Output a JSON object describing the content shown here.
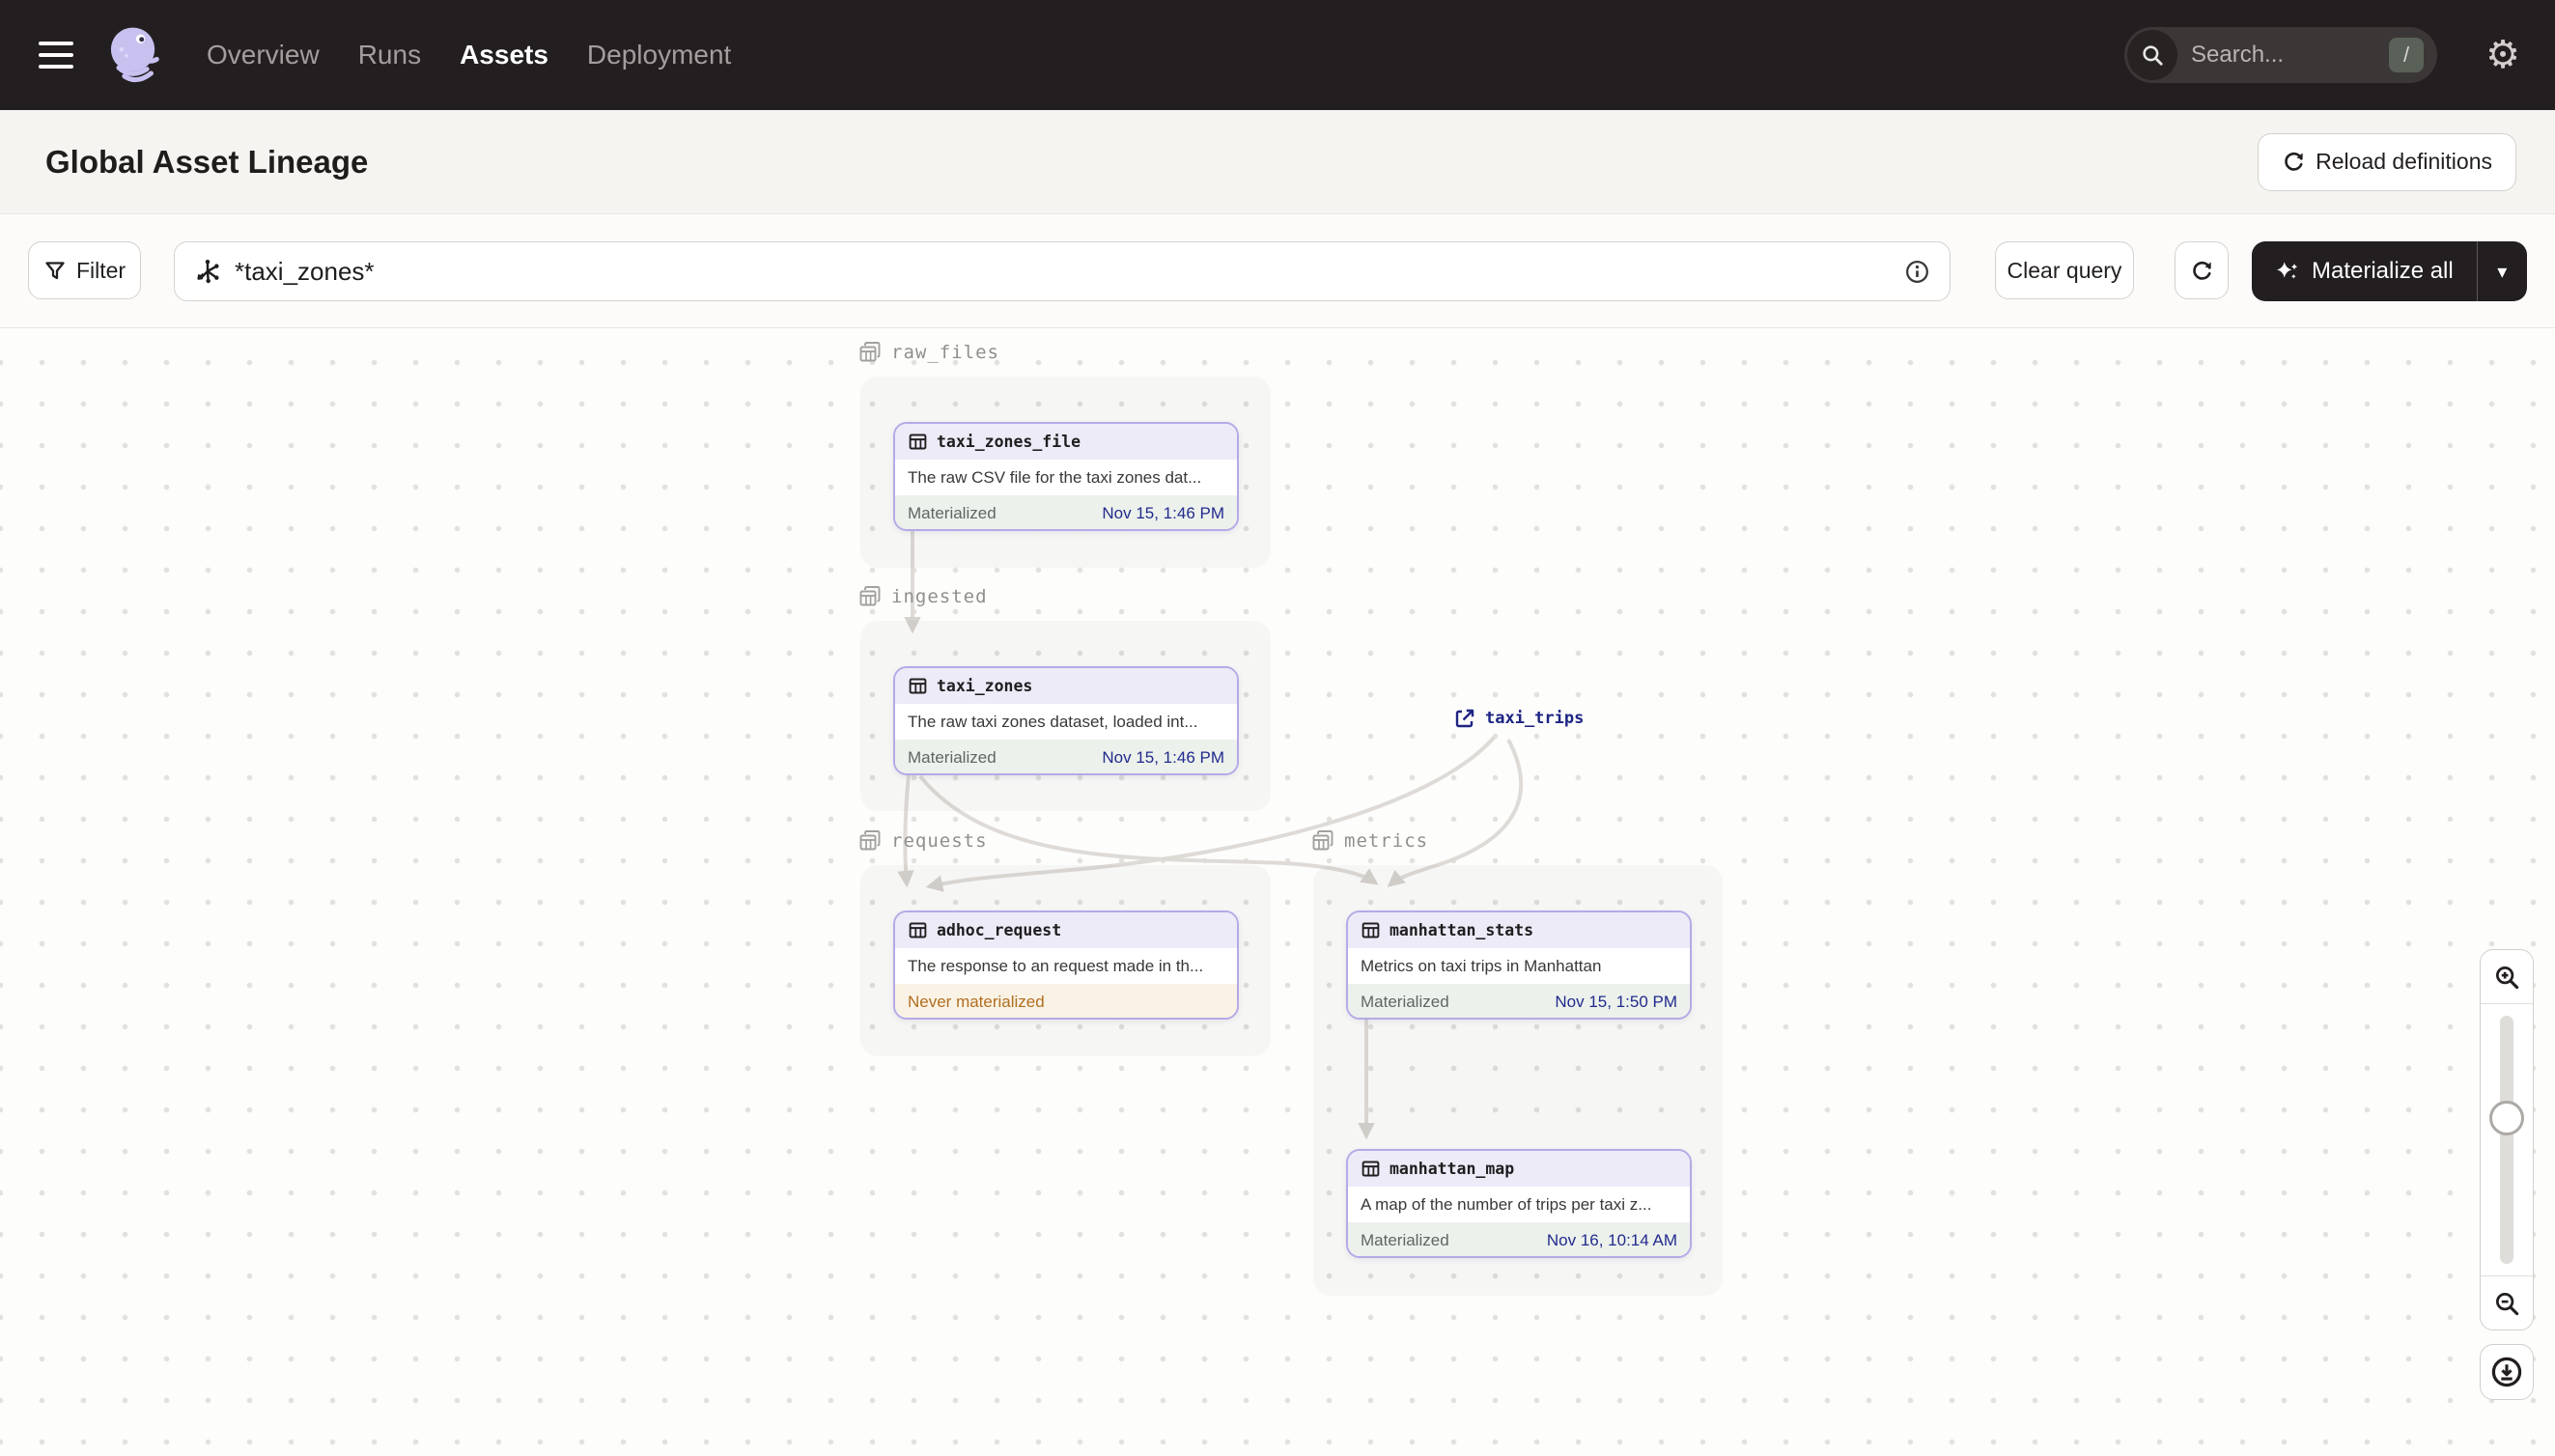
{
  "nav": {
    "items": [
      {
        "label": "Overview",
        "active": false
      },
      {
        "label": "Runs",
        "active": false
      },
      {
        "label": "Assets",
        "active": true
      },
      {
        "label": "Deployment",
        "active": false
      }
    ],
    "search": {
      "placeholder": "Search...",
      "shortcut": "/"
    }
  },
  "header": {
    "title": "Global Asset Lineage",
    "reload_label": "Reload definitions"
  },
  "toolbar": {
    "filter_label": "Filter",
    "query_value": "*taxi_zones*",
    "clear_label": "Clear query",
    "materialize_label": "Materialize all"
  },
  "graph": {
    "groups": [
      {
        "name": "raw_files"
      },
      {
        "name": "ingested"
      },
      {
        "name": "requests"
      },
      {
        "name": "metrics"
      }
    ],
    "nodes": [
      {
        "title": "taxi_zones_file",
        "group": "raw_files",
        "description": "The raw CSV file for the taxi zones dat...",
        "status": "Materialized",
        "timestamp": "Nov 15, 1:46 PM"
      },
      {
        "title": "taxi_zones",
        "group": "ingested",
        "description": "The raw taxi zones dataset, loaded int...",
        "status": "Materialized",
        "timestamp": "Nov 15, 1:46 PM"
      },
      {
        "title": "adhoc_request",
        "group": "requests",
        "description": "The response to an request made in th...",
        "status": "Never materialized",
        "timestamp": ""
      },
      {
        "title": "manhattan_stats",
        "group": "metrics",
        "description": "Metrics on taxi trips in Manhattan",
        "status": "Materialized",
        "timestamp": "Nov 15, 1:50 PM"
      },
      {
        "title": "manhattan_map",
        "group": "metrics",
        "description": "A map of the number of trips per taxi z...",
        "status": "Materialized",
        "timestamp": "Nov 16, 10:14 AM"
      }
    ],
    "external": {
      "title": "taxi_trips"
    }
  },
  "icons": {
    "menu": "hamburger",
    "logo": "dagster-octopus",
    "search": "magnifier",
    "settings_glyph": "⚙",
    "reload": "refresh-arrow",
    "filter": "funnel",
    "asset_selection": "asterisk-graph",
    "info": "info-circle",
    "materialize": "sparkle",
    "dropdown_glyph": "▾",
    "group": "table-stack",
    "asset": "table-grid",
    "external_asset": "external-link",
    "zoom_in": "magnifier-plus",
    "zoom_out": "magnifier-minus",
    "download": "download-circle"
  },
  "colors": {
    "nav_bg": "#231F20",
    "node_border": "#B6A9E6",
    "node_header_bg": "#EDEBF8",
    "materialized_bg": "#ECF1EC",
    "materialized_time": "#222B8C",
    "never_materialized_bg": "#FAF3E5",
    "never_materialized_text": "#B06E22",
    "external_link": "#1D2482",
    "edge": "#DEDBD7"
  }
}
